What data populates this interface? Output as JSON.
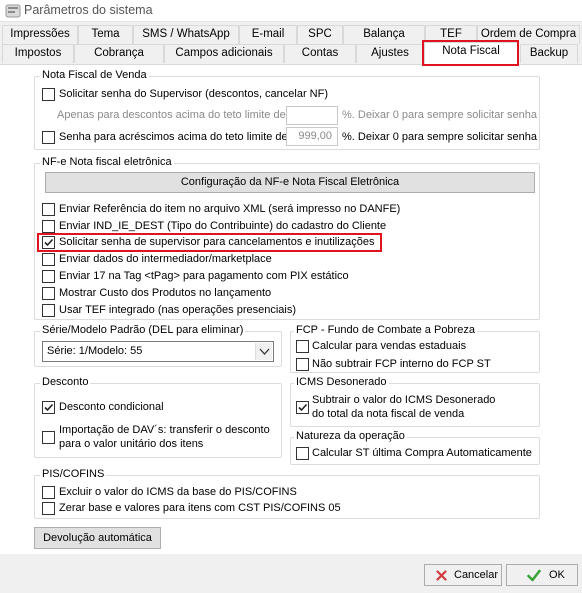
{
  "window": {
    "title": "Parâmetros do sistema"
  },
  "tabs_row1": [
    "Impressões",
    "Tema",
    "SMS / WhatsApp",
    "E-mail",
    "SPC",
    "Balança",
    "TEF",
    "Ordem de Compra"
  ],
  "tabs_row2": [
    "Impostos",
    "Cobrança",
    "Campos adicionais",
    "Contas",
    "Ajustes",
    "Nota Fiscal",
    "Backup"
  ],
  "active_tab": "Nota Fiscal",
  "nfv": {
    "title": "Nota Fiscal de Venda",
    "cb1": "Solicitar senha do Supervisor (descontos, cancelar NF)",
    "apenas": "Apenas para descontos acima do teto limite de:",
    "val1": "",
    "pct1": "%. Deixar 0 para sempre solicitar senha",
    "cb2": "Senha para acréscimos acima do teto limite de:",
    "val2": "999,00",
    "pct2": "%. Deixar 0 para sempre solicitar senha"
  },
  "nfe": {
    "title": "NF-e Nota fiscal eletrônica",
    "config_button": "Configuração da NF-e Nota Fiscal Eletrônica",
    "items": [
      {
        "label": "Enviar Referência do item no arquivo XML (será impresso no DANFE)",
        "checked": false
      },
      {
        "label": "Enviar IND_IE_DEST (Tipo do Contribuinte) do cadastro do Cliente",
        "checked": false
      },
      {
        "label": "Solicitar senha de supervisor para cancelamentos e inutilizações",
        "checked": true
      },
      {
        "label": "Enviar dados do intermediador/marketplace",
        "checked": false
      },
      {
        "label": "Enviar 17 na Tag <tPag> para pagamento com PIX estático",
        "checked": false
      },
      {
        "label": "Mostrar Custo dos Produtos no lançamento",
        "checked": false
      },
      {
        "label": "Usar TEF integrado (nas operações presenciais)",
        "checked": false
      }
    ]
  },
  "serie": {
    "title": "Série/Modelo Padrão (DEL para eliminar)",
    "value": "Série: 1/Modelo: 55"
  },
  "fcp": {
    "title": "FCP - Fundo de Combate a Pobreza",
    "items": [
      {
        "label": "Calcular para vendas estaduais",
        "checked": false
      },
      {
        "label": "Não subtrair FCP interno do FCP ST",
        "checked": false
      }
    ]
  },
  "desconto": {
    "title": "Desconto",
    "cb1": "Desconto condicional",
    "cb2_line1": "Importação de DAV´s: transferir o desconto",
    "cb2_line2": "para o valor unitário dos itens"
  },
  "icms": {
    "title": "ICMS Desonerado",
    "line1": "Subtrair o valor do ICMS Desonerado",
    "line2": "do total da nota fiscal de venda"
  },
  "natureza": {
    "title": "Natureza da operação",
    "cb": "Calcular ST última Compra Automaticamente"
  },
  "pis": {
    "title": "PIS/COFINS",
    "cb1": "Excluir o valor do ICMS da base do PIS/COFINS",
    "cb2": "Zerar base e valores para itens com CST PIS/COFINS 05"
  },
  "devolucao_button": "Devolução automática",
  "cancel_button": "Cancelar",
  "ok_button": "OK",
  "colors": {
    "highlight": "#e0141e",
    "ok_check": "#3aa33a",
    "cancel_x": "#d23c3c"
  }
}
